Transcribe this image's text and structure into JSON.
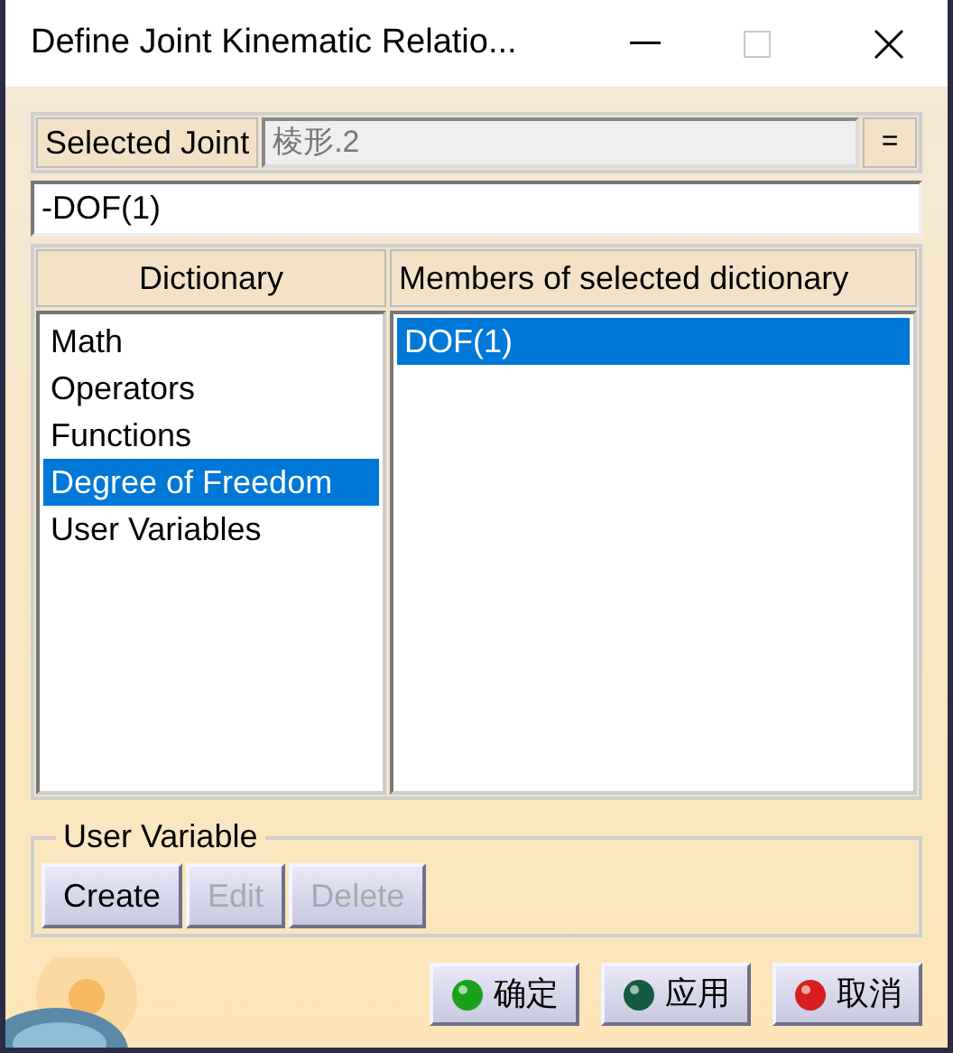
{
  "window": {
    "title": "Define Joint Kinematic Relatio..."
  },
  "selected_joint": {
    "label": "Selected Joint",
    "value": "棱形.2",
    "button": "="
  },
  "formula": {
    "value": "-DOF(1)"
  },
  "dictionary": {
    "header": "Dictionary",
    "items": [
      {
        "label": "Math",
        "selected": false
      },
      {
        "label": "Operators",
        "selected": false
      },
      {
        "label": "Functions",
        "selected": false
      },
      {
        "label": "Degree of Freedom",
        "selected": true
      },
      {
        "label": "User Variables",
        "selected": false
      }
    ]
  },
  "members": {
    "header": "Members of selected dictionary",
    "items": [
      {
        "label": "DOF(1)",
        "selected": true
      }
    ]
  },
  "user_variable": {
    "title": "User Variable",
    "buttons": [
      {
        "label": "Create",
        "disabled": false
      },
      {
        "label": "Edit",
        "disabled": true
      },
      {
        "label": "Delete",
        "disabled": true
      }
    ]
  },
  "dialog_buttons": [
    {
      "label": "确定",
      "color": "#1aa01a"
    },
    {
      "label": "应用",
      "color": "#145a40"
    },
    {
      "label": "取消",
      "color": "#d81e1e"
    }
  ]
}
